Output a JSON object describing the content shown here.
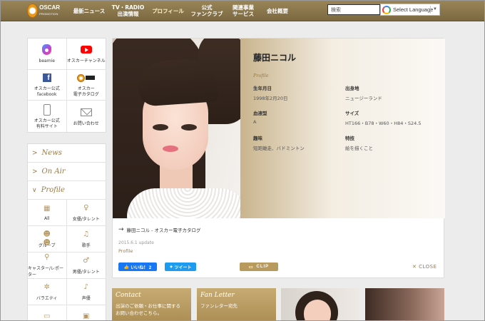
{
  "header": {
    "logo_text": "OSCAR",
    "logo_sub": "PROMOTION",
    "nav": [
      {
        "label": "最新ニュース"
      },
      {
        "label": "TV・RADIO\n出演情報"
      },
      {
        "label": "プロフィール"
      },
      {
        "label": "公式\nファンクラブ"
      },
      {
        "label": "関連事業\nサービス"
      },
      {
        "label": "会社概要"
      }
    ],
    "search_placeholder": "検索",
    "language_label": "Select Language"
  },
  "sidebar": {
    "links": [
      {
        "label": "beamie",
        "icon": "beamie-icon"
      },
      {
        "label": "オスカーチャンネル",
        "icon": "youtube-icon"
      },
      {
        "label": "オスカー公式\nfacebook",
        "icon": "facebook-icon"
      },
      {
        "label": "オスカー\n電子カタログ",
        "icon": "oscar-catalog-icon"
      },
      {
        "label": "オスカー公式\n有料サイト",
        "icon": "smartphone-icon"
      },
      {
        "label": "お問い合わせ",
        "icon": "mail-icon"
      }
    ],
    "menu": [
      {
        "label": "News",
        "arrow": ">"
      },
      {
        "label": "On Air",
        "arrow": ">"
      },
      {
        "label": "Profile",
        "arrow": "∨"
      }
    ],
    "profile_categories": [
      {
        "label": "All",
        "icon": "grid-icon"
      },
      {
        "label": "女優/タレント",
        "icon": "actress-icon"
      },
      {
        "label": "グループ",
        "icon": "group-icon"
      },
      {
        "label": "歌手",
        "icon": "music-note-icon"
      },
      {
        "label": "キャスター/レポーター",
        "icon": "microphone-icon"
      },
      {
        "label": "男優/タレント",
        "icon": "actor-icon"
      },
      {
        "label": "バラエティ",
        "icon": "variety-icon"
      },
      {
        "label": "声優",
        "icon": "voice-mic-icon"
      },
      {
        "label": "",
        "icon": "book-icon"
      },
      {
        "label": "",
        "icon": "box-icon"
      }
    ]
  },
  "profile": {
    "name": "藤田ニコル",
    "section_label": "Profile",
    "fields": [
      {
        "key": "生年月日",
        "value": "1998年2月20日"
      },
      {
        "key": "出身地",
        "value": "ニュージーランド"
      },
      {
        "key": "血液型",
        "value": "A"
      },
      {
        "key": "サイズ",
        "value": "HT166・B78・W60・H84・S24.5"
      },
      {
        "key": "趣味",
        "value": "短距離走、バドミントン"
      },
      {
        "key": "特技",
        "value": "絵を描くこと"
      }
    ],
    "catalog_link": "藤田ニコル - オスカー電子カタログ",
    "updated": "2015.6.1 update",
    "profile_link": "Profile",
    "like_label": "いいね！ 2",
    "tweet_label": "ツイート",
    "clip_label": "CLIP",
    "close_label": "CLOSE"
  },
  "tiles": {
    "contact_title": "Contact",
    "contact_desc": "出演のご依頼・お仕事に関する\nお問い合わせこちら。",
    "fan_title": "Fan Letter",
    "fan_desc": "ファンレター宛先"
  }
}
